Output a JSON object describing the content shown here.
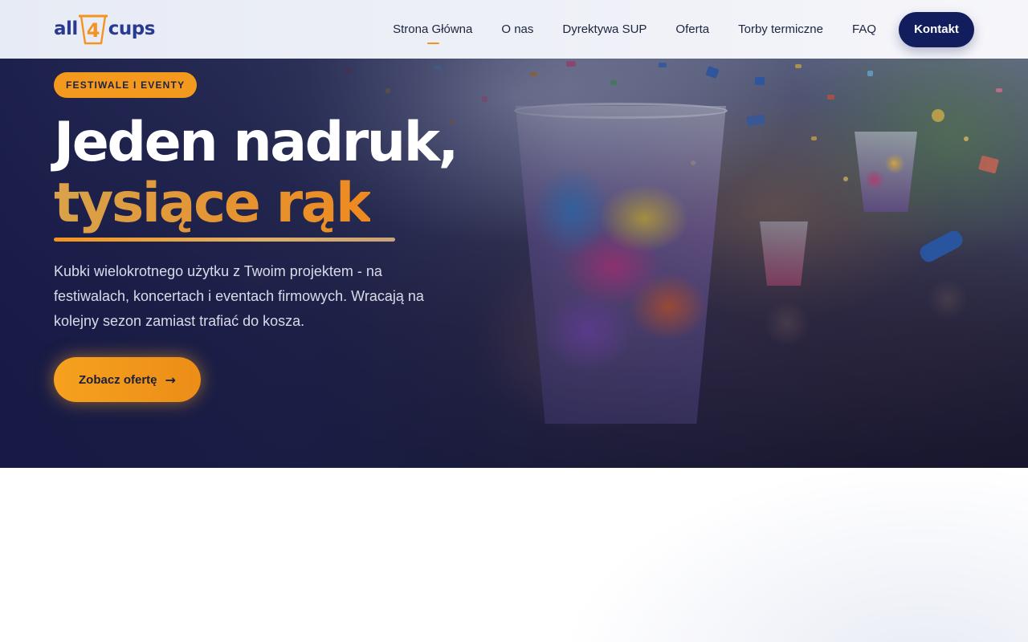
{
  "brand": {
    "logo_left": "all",
    "logo_mid": "4",
    "logo_right": "cups",
    "colors": {
      "navy": "#121d5e",
      "orange": "#f39a1e",
      "logo_blue": "#2a3a92"
    }
  },
  "nav": {
    "items": [
      {
        "label": "Strona Główna",
        "active": true
      },
      {
        "label": "O nas",
        "active": false
      },
      {
        "label": "Dyrektywa SUP",
        "active": false
      },
      {
        "label": "Oferta",
        "active": false
      },
      {
        "label": "Torby termiczne",
        "active": false
      },
      {
        "label": "FAQ",
        "active": false
      }
    ],
    "cta_label": "Kontakt"
  },
  "hero": {
    "badge": "FESTIWALE I EVENTY",
    "title_line1": "Jeden nadruk,",
    "title_line2": "tysiące rąk",
    "lead": "Kubki wielokrotnego użytku z Twoim projektem - na festiwalach, koncertach i eventach firmowych. Wracają na kolejny sezon zamiast trafiać do kosza.",
    "button_label": "Zobacz ofertę",
    "button_icon": "arrow-right-icon",
    "background_image": "festival-crowd-holding-printed-cups"
  }
}
